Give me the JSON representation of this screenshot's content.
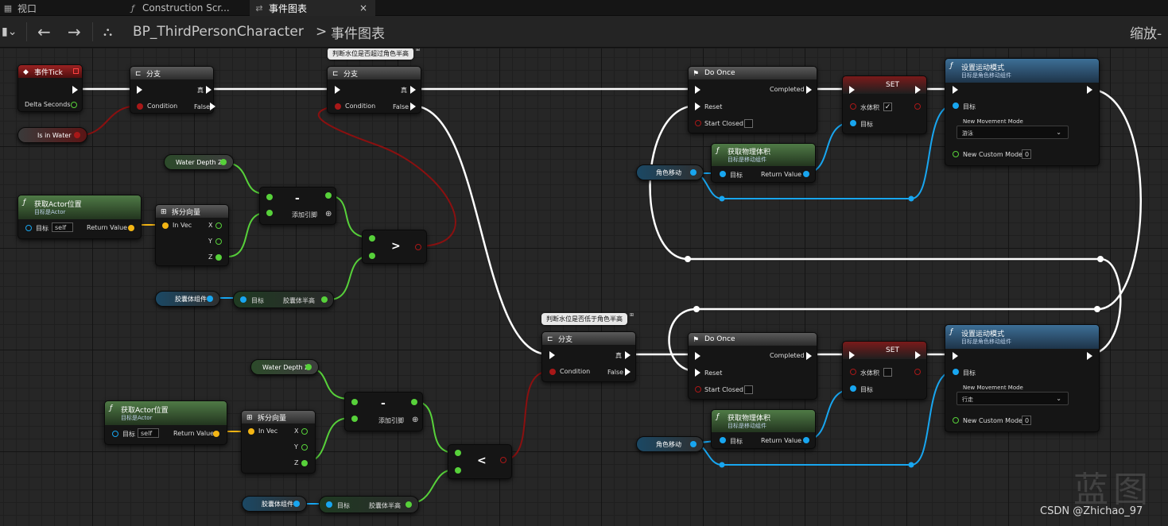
{
  "tabs": [
    {
      "label": "视口",
      "icon": "viewport-icon"
    },
    {
      "label": "Construction Scr...",
      "icon": "function-icon"
    },
    {
      "label": "事件图表",
      "icon": "graph-icon",
      "close": "×"
    }
  ],
  "toolbar": {
    "back_icon": "←",
    "forward_icon": "→",
    "blueprint_name": "BP_ThirdPersonCharacter",
    "separator": ">",
    "graph_name": "事件图表",
    "zoom_label": "缩放-"
  },
  "comments": {
    "upper": "判断水位是否超过角色半高",
    "lower": "判断水位是否低于角色半高"
  },
  "nodes": {
    "event_tick": {
      "title": "事件Tick",
      "delta": "Delta Seconds"
    },
    "is_in_water": {
      "label": "Is in Water"
    },
    "branch1": {
      "title": "分支",
      "condition": "Condition",
      "true": "真",
      "false": "False"
    },
    "branch2": {
      "title": "分支",
      "condition": "Condition",
      "true": "真",
      "false": "False"
    },
    "branch3": {
      "title": "分支",
      "condition": "Condition",
      "true": "真",
      "false": "False"
    },
    "water_depth_1": {
      "label": "Water Depth Z"
    },
    "water_depth_2": {
      "label": "Water Depth Z"
    },
    "get_actor_loc_1": {
      "title": "获取Actor位置",
      "subtitle": "目标是Actor",
      "target": "目标",
      "self": "self",
      "ret": "Return Value"
    },
    "get_actor_loc_2": {
      "title": "获取Actor位置",
      "subtitle": "目标是Actor",
      "target": "目标",
      "self": "self",
      "ret": "Return Value"
    },
    "break_vec_1": {
      "title": "拆分向量",
      "in": "In Vec",
      "x": "X",
      "y": "Y",
      "z": "Z"
    },
    "break_vec_2": {
      "title": "拆分向量",
      "in": "In Vec",
      "x": "X",
      "y": "Y",
      "z": "Z"
    },
    "subtract_1": {
      "op": "-",
      "add_pin": "添加引脚"
    },
    "subtract_2": {
      "op": "-",
      "add_pin": "添加引脚"
    },
    "greater": {
      "op": ">"
    },
    "less": {
      "op": "<"
    },
    "capsule_var_1": {
      "label": "胶囊体组件"
    },
    "capsule_var_2": {
      "label": "胶囊体组件"
    },
    "half_height_1": {
      "target": "目标",
      "ret": "胶囊体半高"
    },
    "half_height_2": {
      "target": "目标",
      "ret": "胶囊体半高"
    },
    "do_once_1": {
      "title": "Do Once",
      "completed": "Completed",
      "reset": "Reset",
      "start_closed": "Start Closed"
    },
    "do_once_2": {
      "title": "Do Once",
      "completed": "Completed",
      "reset": "Reset",
      "start_closed": "Start Closed"
    },
    "set_1": {
      "title": "SET",
      "var": "水体积",
      "target": "目标",
      "checked": "✓"
    },
    "set_2": {
      "title": "SET",
      "var": "水体积",
      "target": "目标",
      "checked": ""
    },
    "get_phys_vol_1": {
      "title": "获取物理体积",
      "subtitle": "目标是移动组件",
      "target": "目标",
      "ret": "Return Value"
    },
    "get_phys_vol_2": {
      "title": "获取物理体积",
      "subtitle": "目标是移动组件",
      "target": "目标",
      "ret": "Return Value"
    },
    "char_move_var_1": {
      "label": "角色移动"
    },
    "char_move_var_2": {
      "label": "角色移动"
    },
    "set_move_mode_1": {
      "title": "设置运动模式",
      "subtitle": "目标是角色移动组件",
      "target": "目标",
      "mode_label": "New Movement Mode",
      "mode_value": "游泳",
      "custom_label": "New Custom Mode",
      "custom_value": "0"
    },
    "set_move_mode_2": {
      "title": "设置运动模式",
      "subtitle": "目标是角色移动组件",
      "target": "目标",
      "mode_label": "New Movement Mode",
      "mode_value": "行走",
      "custom_label": "New Custom Mode",
      "custom_value": "0"
    }
  },
  "colors": {
    "exec": "#ffffff",
    "bool": "#a81818",
    "float": "#57d13a",
    "object": "#18a6f0",
    "vector": "#f3b514"
  },
  "watermark": "蓝图",
  "credit": "CSDN @Zhichao_97"
}
